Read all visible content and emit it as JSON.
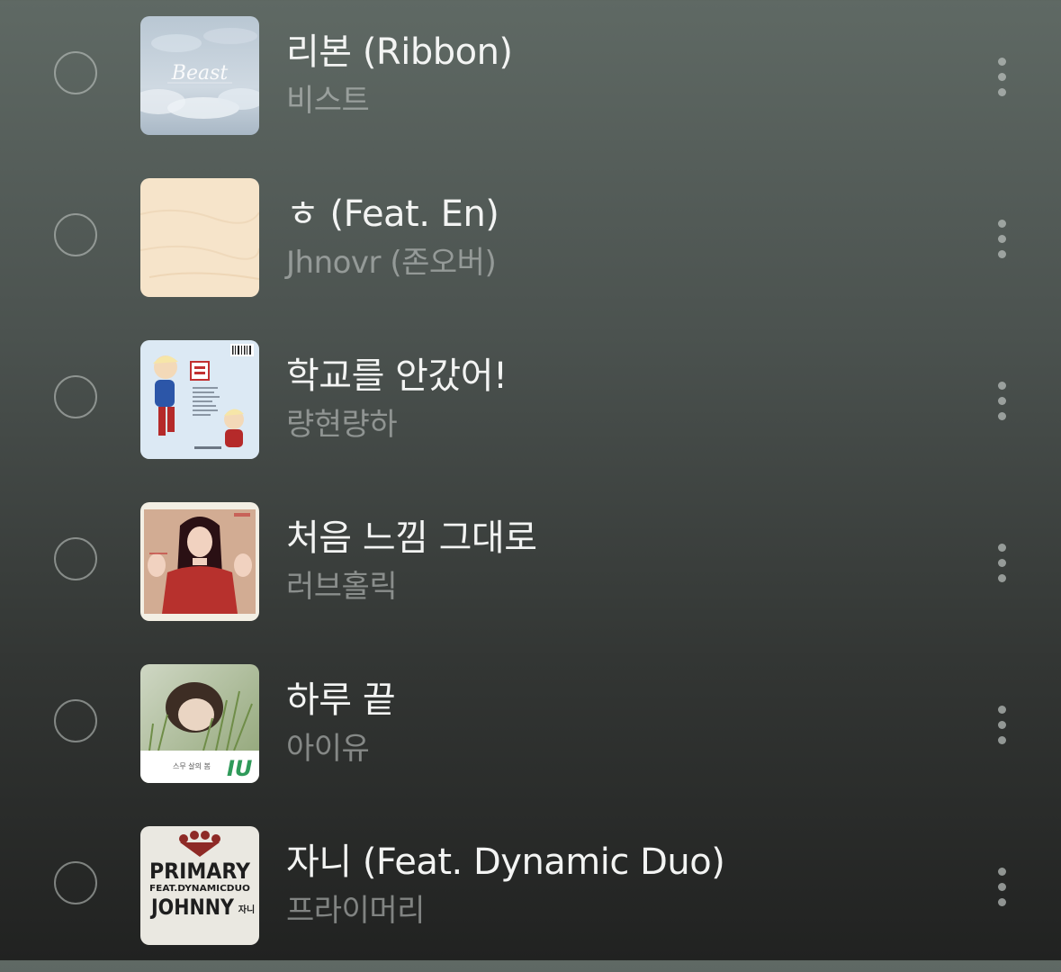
{
  "tracks": [
    {
      "title": "리본 (Ribbon)",
      "artist": "비스트",
      "cover_icon": "album-cover-beast",
      "cover_text": "Beast"
    },
    {
      "title": "ㅎ (Feat. En)",
      "artist": "Jhnovr (존오버)",
      "cover_icon": "album-cover-beige"
    },
    {
      "title": "학교를 안갔어!",
      "artist": "량현량하",
      "cover_icon": "album-cover-kids"
    },
    {
      "title": "처음 느낌 그대로",
      "artist": "러브홀릭",
      "cover_icon": "album-cover-red-girl"
    },
    {
      "title": "하루 끝",
      "artist": "아이유",
      "cover_icon": "album-cover-iu",
      "cover_text": "IU",
      "cover_subtext": "스무 살의 봄"
    },
    {
      "title": "자니 (Feat. Dynamic Duo)",
      "artist": "프라이머리",
      "cover_icon": "album-cover-primary",
      "cover_text": "PRIMARY",
      "cover_feat": "FEAT.DYNAMICDUO",
      "cover_title": "JOHNNY",
      "cover_korean": "자니"
    }
  ]
}
